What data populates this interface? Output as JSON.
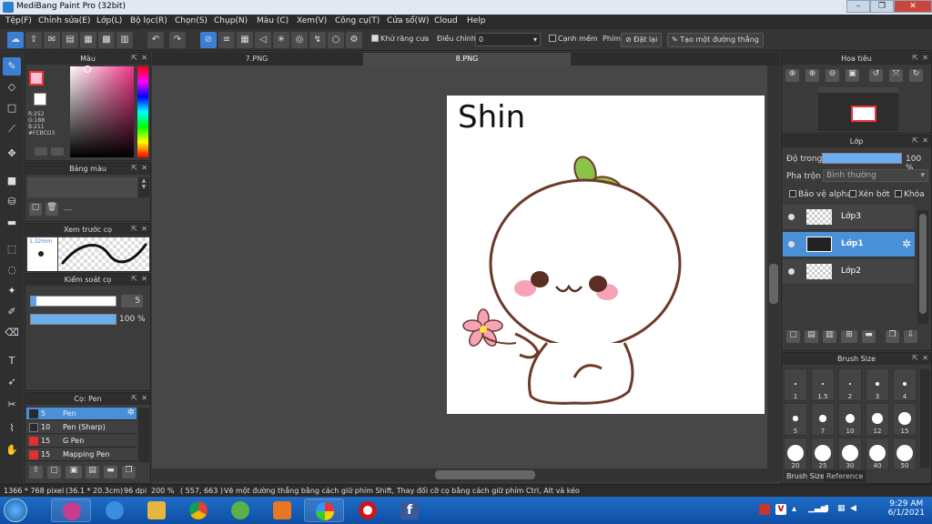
{
  "window": {
    "title": "MediBang Paint Pro (32bit)"
  },
  "menu": [
    "Tệp(F)",
    "Chỉnh sửa(E)",
    "Lớp(L)",
    "Bộ lọc(R)",
    "Chọn(S)",
    "Chụp(N)",
    "Màu (C)",
    "Xem(V)",
    "Công cụ(T)",
    "Cửa sổ(W)",
    "Cloud",
    "Help"
  ],
  "toolbar": {
    "antialias_label": "Khử răng cưa",
    "adjust_label": "Điều chỉnh",
    "adjust_value": "0",
    "edge_label": "Cạnh mềm",
    "pen_label": "Phím",
    "reset_label": "Đặt lại",
    "straight_label": "Tạo một đường thẳng"
  },
  "color_panel": {
    "title": "Màu",
    "r": "R:252",
    "g": "G:188",
    "b": "B:211",
    "hex": "#FCBCD3",
    "fg_color": "#fcbcd3"
  },
  "palette_panel": {
    "title": "Bảng màu",
    "info": "---"
  },
  "brush_preview": {
    "title": "Xem trước cọ",
    "size": "1.32mm"
  },
  "brush_control": {
    "title": "Kiểm soát cọ",
    "size_value": "5",
    "opacity_value": "100 %"
  },
  "brush_list": {
    "title": "Cọ: Pen",
    "items": [
      {
        "num": "5",
        "name": "Pen",
        "color": "#2b2b2b"
      },
      {
        "num": "10",
        "name": "Pen (Sharp)",
        "color": "#2b2b2b"
      },
      {
        "num": "15",
        "name": "G Pen",
        "color": "#e03030"
      },
      {
        "num": "15",
        "name": "Mapping Pen",
        "color": "#e03030"
      }
    ]
  },
  "tabs": [
    "7.PNG",
    "8.PNG"
  ],
  "canvas_text": "Shin",
  "navigator": {
    "title": "Hoa tiêu"
  },
  "layers": {
    "title": "Lớp",
    "opacity_label": "Độ trong",
    "opacity_value": "100 %",
    "opacity_fraction": 1.0,
    "blend_label": "Pha trộn",
    "blend_value": "Bình thường",
    "protect_alpha": "Bảo vệ alpha",
    "clipping": "Xén bớt",
    "lock": "Khóa",
    "items": [
      {
        "name": "Lớp3"
      },
      {
        "name": "Lớp1"
      },
      {
        "name": "Lớp2"
      }
    ]
  },
  "brush_size": {
    "title": "Brush Size",
    "sizes": [
      "1",
      "1.5",
      "2",
      "3",
      "4",
      "5",
      "7",
      "10",
      "12",
      "15",
      "20",
      "25",
      "30",
      "40",
      "50"
    ],
    "tab1": "Brush Size",
    "tab2": "Reference"
  },
  "status": {
    "dims": "1366 * 768 pixel",
    "cm": "(36.1 * 20.3cm)",
    "dpi": "96 dpi",
    "zoom": "200 %",
    "coords": "( 557, 663 )",
    "hint": "Vẽ một đường thẳng bằng cách giữ phím Shift, Thay đổi cỡ cọ bằng cách giữ phím Ctrl, Alt và kéo"
  },
  "clock": {
    "time": "9:29 AM",
    "date": "6/1/2021"
  }
}
